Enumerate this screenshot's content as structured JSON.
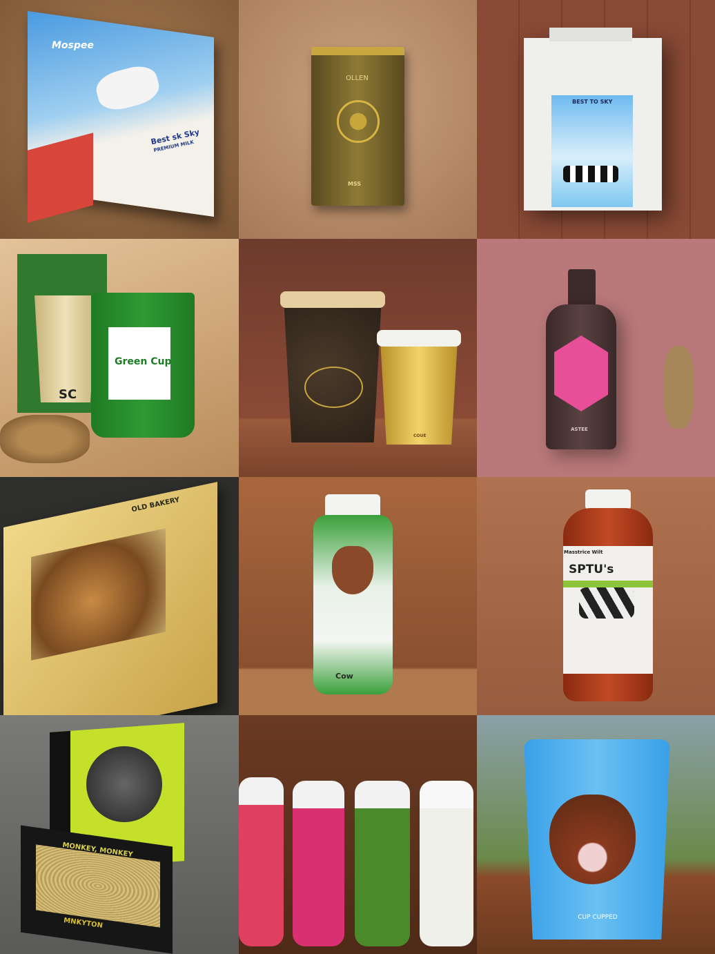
{
  "tiles": [
    {
      "name": "milk-box-jumping-cow",
      "brand": "Mospee",
      "tagline": "Best sk Sky",
      "sub": "PREMIUM MILK"
    },
    {
      "name": "gold-coffee-pouch",
      "brand": "OLLEN",
      "sub": "MSS"
    },
    {
      "name": "white-box-cows",
      "title": "BEST TO SKY"
    },
    {
      "name": "green-cup-packaging",
      "title": "Green Cup",
      "cup_text": "SC"
    },
    {
      "name": "coffee-cups-bull",
      "cup_text": "COUE"
    },
    {
      "name": "dark-bottle-pink-label",
      "label": "ASTEE"
    },
    {
      "name": "gold-box-bread",
      "title": "OLD BAKERY"
    },
    {
      "name": "green-bottle-cow",
      "label": "Cow"
    },
    {
      "name": "brown-bottle-cow",
      "brand": "Masstrice Wilt",
      "title": "SPTU's"
    },
    {
      "name": "monkey-box",
      "title": "MONKEY, MONKEY",
      "base": "MNKYTON"
    },
    {
      "name": "four-monkey-bottles",
      "colors": [
        "#e04060",
        "#d83070",
        "#4a8a2a",
        "#f0f0ea"
      ]
    },
    {
      "name": "blue-cow-cup",
      "label": "CUP CUPPED"
    }
  ]
}
